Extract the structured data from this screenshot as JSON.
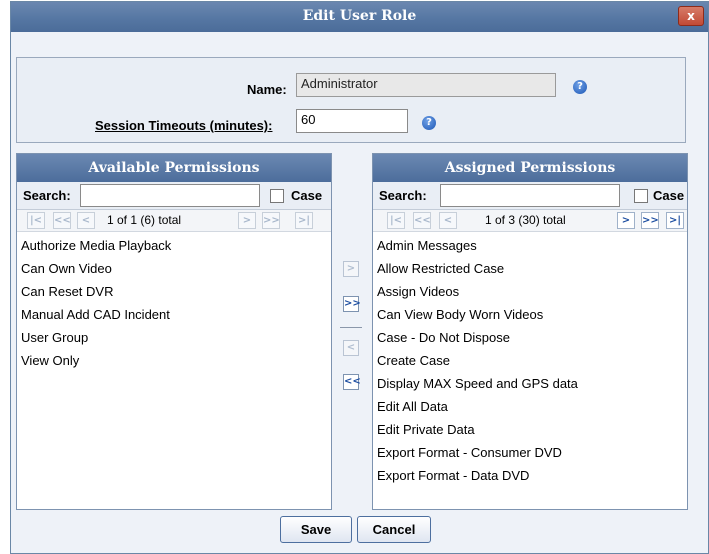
{
  "dialog": {
    "title": "Edit User Role",
    "close_glyph": "x"
  },
  "form": {
    "name_label": "Name:",
    "name_value": "Administrator",
    "timeout_label": "Session Timeouts (minutes):",
    "timeout_value": "60",
    "help_glyph": "?"
  },
  "available": {
    "header": "Available Permissions",
    "search_label": "Search:",
    "search_value": "",
    "case_label": "Case",
    "case_checked": false,
    "pager_text": "1 of 1 (6) total",
    "items": [
      "Authorize Media Playback",
      "Can Own Video",
      "Can Reset DVR",
      "Manual Add CAD Incident",
      "User Group",
      "View Only"
    ]
  },
  "assigned": {
    "header": "Assigned Permissions",
    "search_label": "Search:",
    "search_value": "",
    "case_label": "Case",
    "case_checked": false,
    "pager_text": "1 of 3 (30) total",
    "items": [
      "Admin Messages",
      "Allow Restricted Case",
      "Assign Videos",
      "Can View Body Worn Videos",
      "Case - Do Not Dispose",
      "Create Case",
      "Display MAX Speed and GPS data",
      "Edit All Data",
      "Edit Private Data",
      "Export Format - Consumer DVD",
      "Export Format - Data DVD"
    ]
  },
  "pager_glyphs": {
    "first": "|<",
    "prev_page": "<<",
    "prev": "<",
    "next": ">",
    "next_page": ">>",
    "last": ">|"
  },
  "mover_glyphs": {
    "add": ">",
    "add_all": ">>",
    "remove": "<",
    "remove_all": "<<"
  },
  "buttons": {
    "save": "Save",
    "cancel": "Cancel"
  },
  "colors": {
    "titlebar": "#5677a3",
    "panel_header": "#4c6d9b",
    "active_arrow": "#1d4ea1",
    "close_button": "#c14a35"
  }
}
